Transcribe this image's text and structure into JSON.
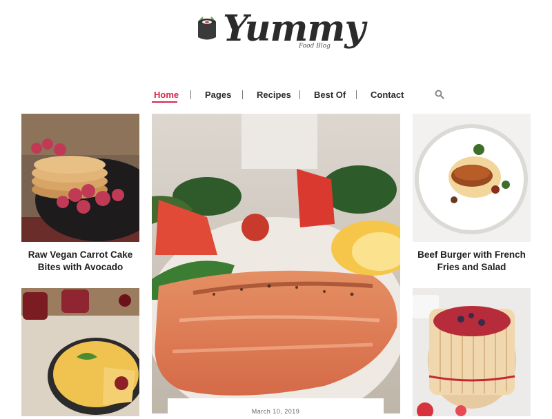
{
  "brand": {
    "name": "Yummy",
    "tagline": "Food Blog"
  },
  "nav": {
    "items": [
      "Home",
      "Pages",
      "Recipes",
      "Best Of",
      "Contact"
    ],
    "active": "Home",
    "accent_color": "#d9264a",
    "search_icon": "search-icon"
  },
  "posts": {
    "left_top": {
      "title_line1": "Raw Vegan Carrot Cake",
      "title_line2": "Bites with Avocado"
    },
    "right_top": {
      "title_line1": "Beef Burger with French",
      "title_line2": "Fries and Salad"
    },
    "featured": {
      "date": "March 10, 2019"
    }
  }
}
